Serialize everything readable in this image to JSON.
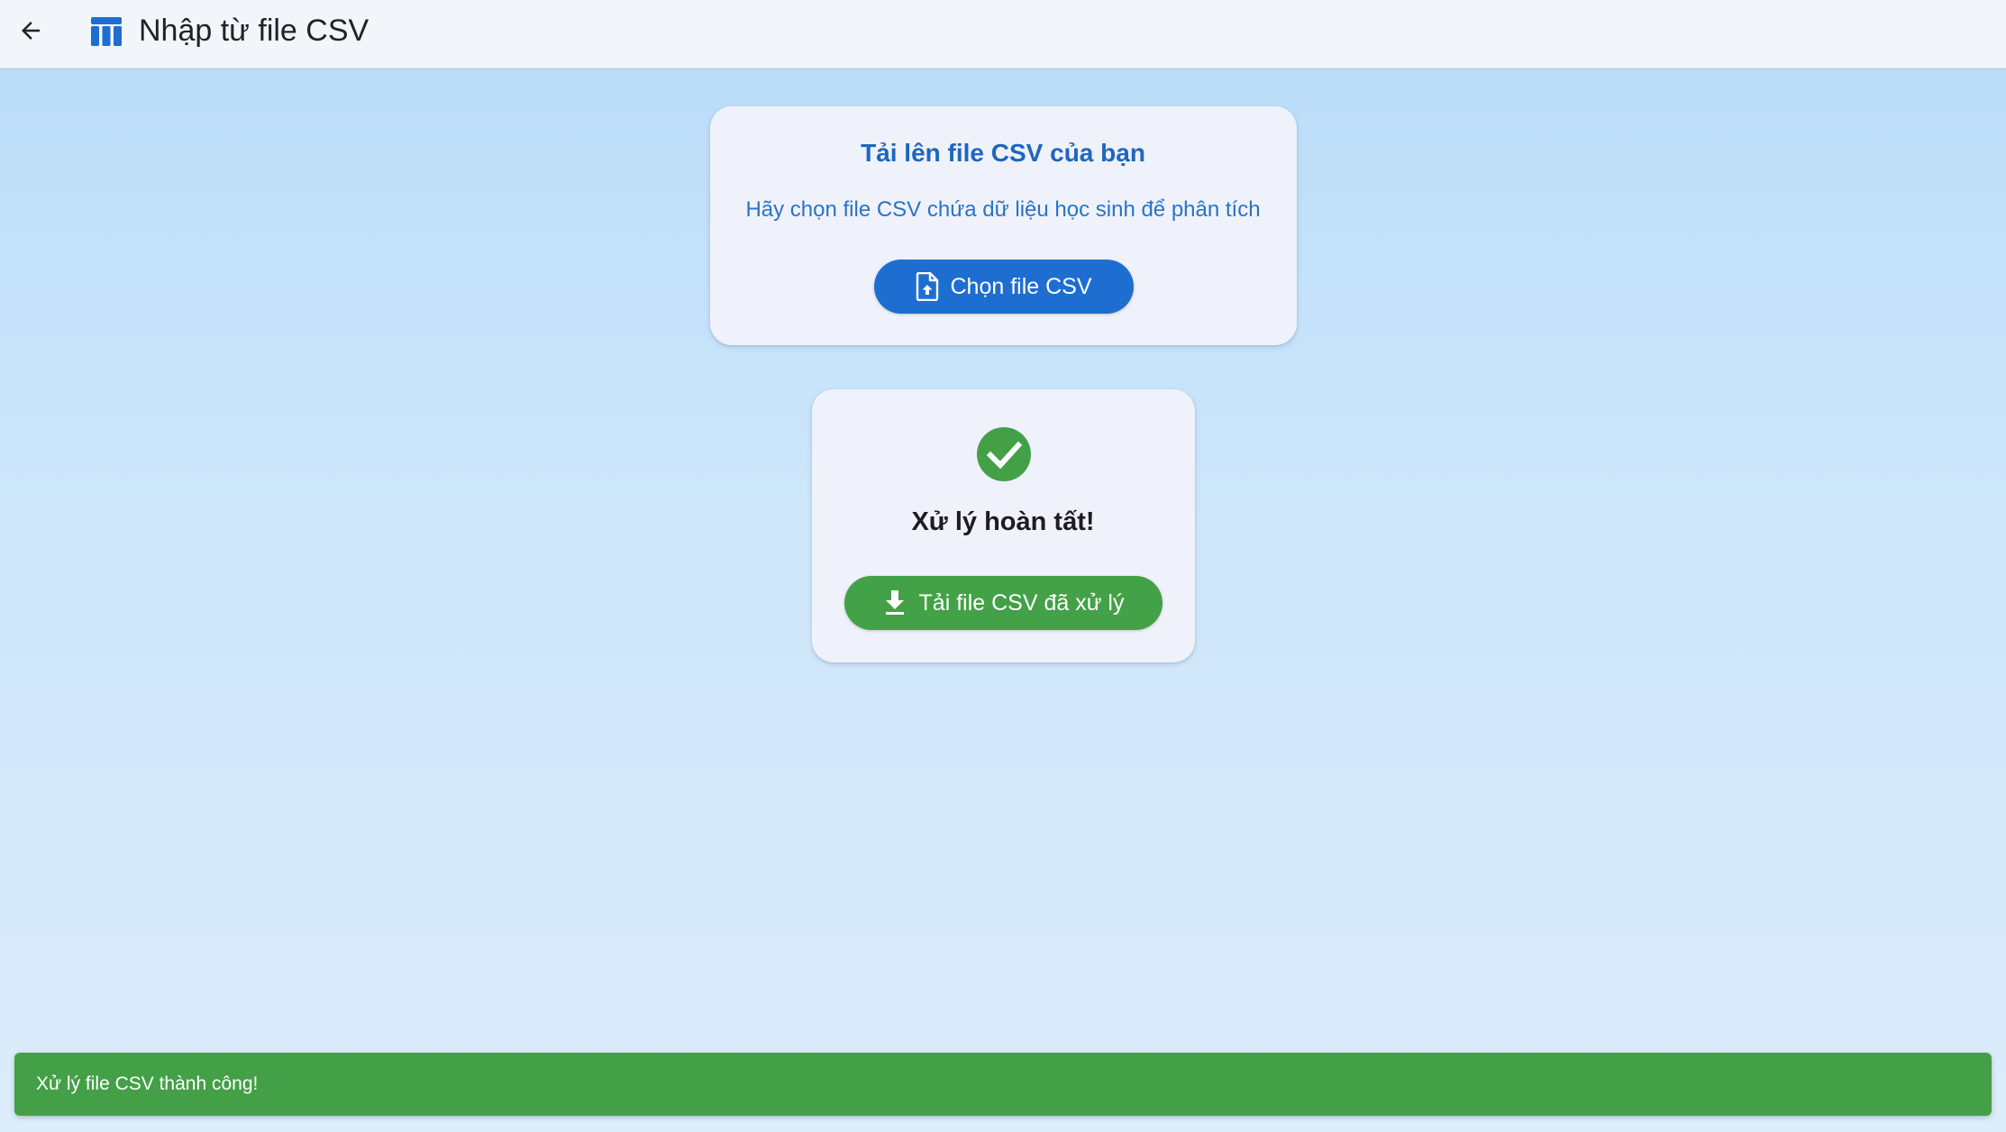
{
  "appbar": {
    "title": "Nhập từ file CSV",
    "back_icon": "arrow-back-icon",
    "app_icon": "table-chart-icon",
    "icon_color": "#1e6ed1"
  },
  "upload_card": {
    "title": "Tải lên file CSV của bạn",
    "subtitle": "Hãy chọn file CSV chứa dữ liệu học sinh để phân tích",
    "button_label": "Chọn file CSV",
    "button_icon": "file-upload-icon",
    "button_color": "#1e6ed1"
  },
  "result_card": {
    "status_icon": "check-circle-icon",
    "title": "Xử lý hoàn tất!",
    "button_label": "Tải file CSV đã xử lý",
    "button_icon": "download-icon",
    "button_color": "#43a147"
  },
  "snackbar": {
    "message": "Xử lý file CSV thành công!",
    "color": "#43a047"
  }
}
